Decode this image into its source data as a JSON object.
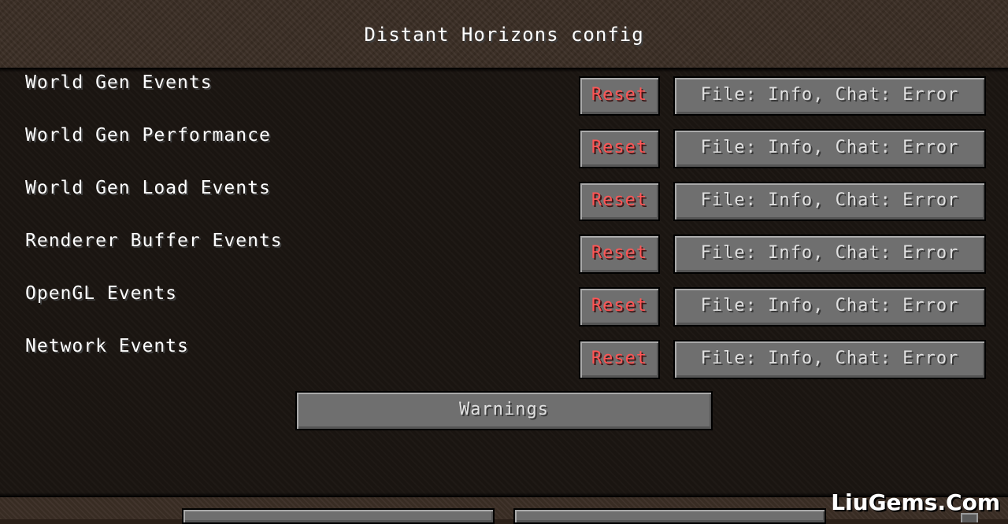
{
  "header": {
    "title": "Distant Horizons config"
  },
  "rows": [
    {
      "label": "World Gen Events",
      "reset_label": "Reset",
      "value": "File: Info, Chat: Error"
    },
    {
      "label": "World Gen Performance",
      "reset_label": "Reset",
      "value": "File: Info, Chat: Error"
    },
    {
      "label": "World Gen Load Events",
      "reset_label": "Reset",
      "value": "File: Info, Chat: Error"
    },
    {
      "label": "Renderer Buffer Events",
      "reset_label": "Reset",
      "value": "File: Info, Chat: Error"
    },
    {
      "label": "OpenGL Events",
      "reset_label": "Reset",
      "value": "File: Info, Chat: Error"
    },
    {
      "label": "Network Events",
      "reset_label": "Reset",
      "value": "File: Info, Chat: Error"
    }
  ],
  "warnings_button": {
    "label": "Warnings"
  },
  "watermark": {
    "text": "LiuGems.Com"
  },
  "colors": {
    "reset_text": "#ff5555",
    "button_face": "#6f6f6f",
    "list_background": "#1b1511",
    "header_background": "#3a2d24"
  }
}
